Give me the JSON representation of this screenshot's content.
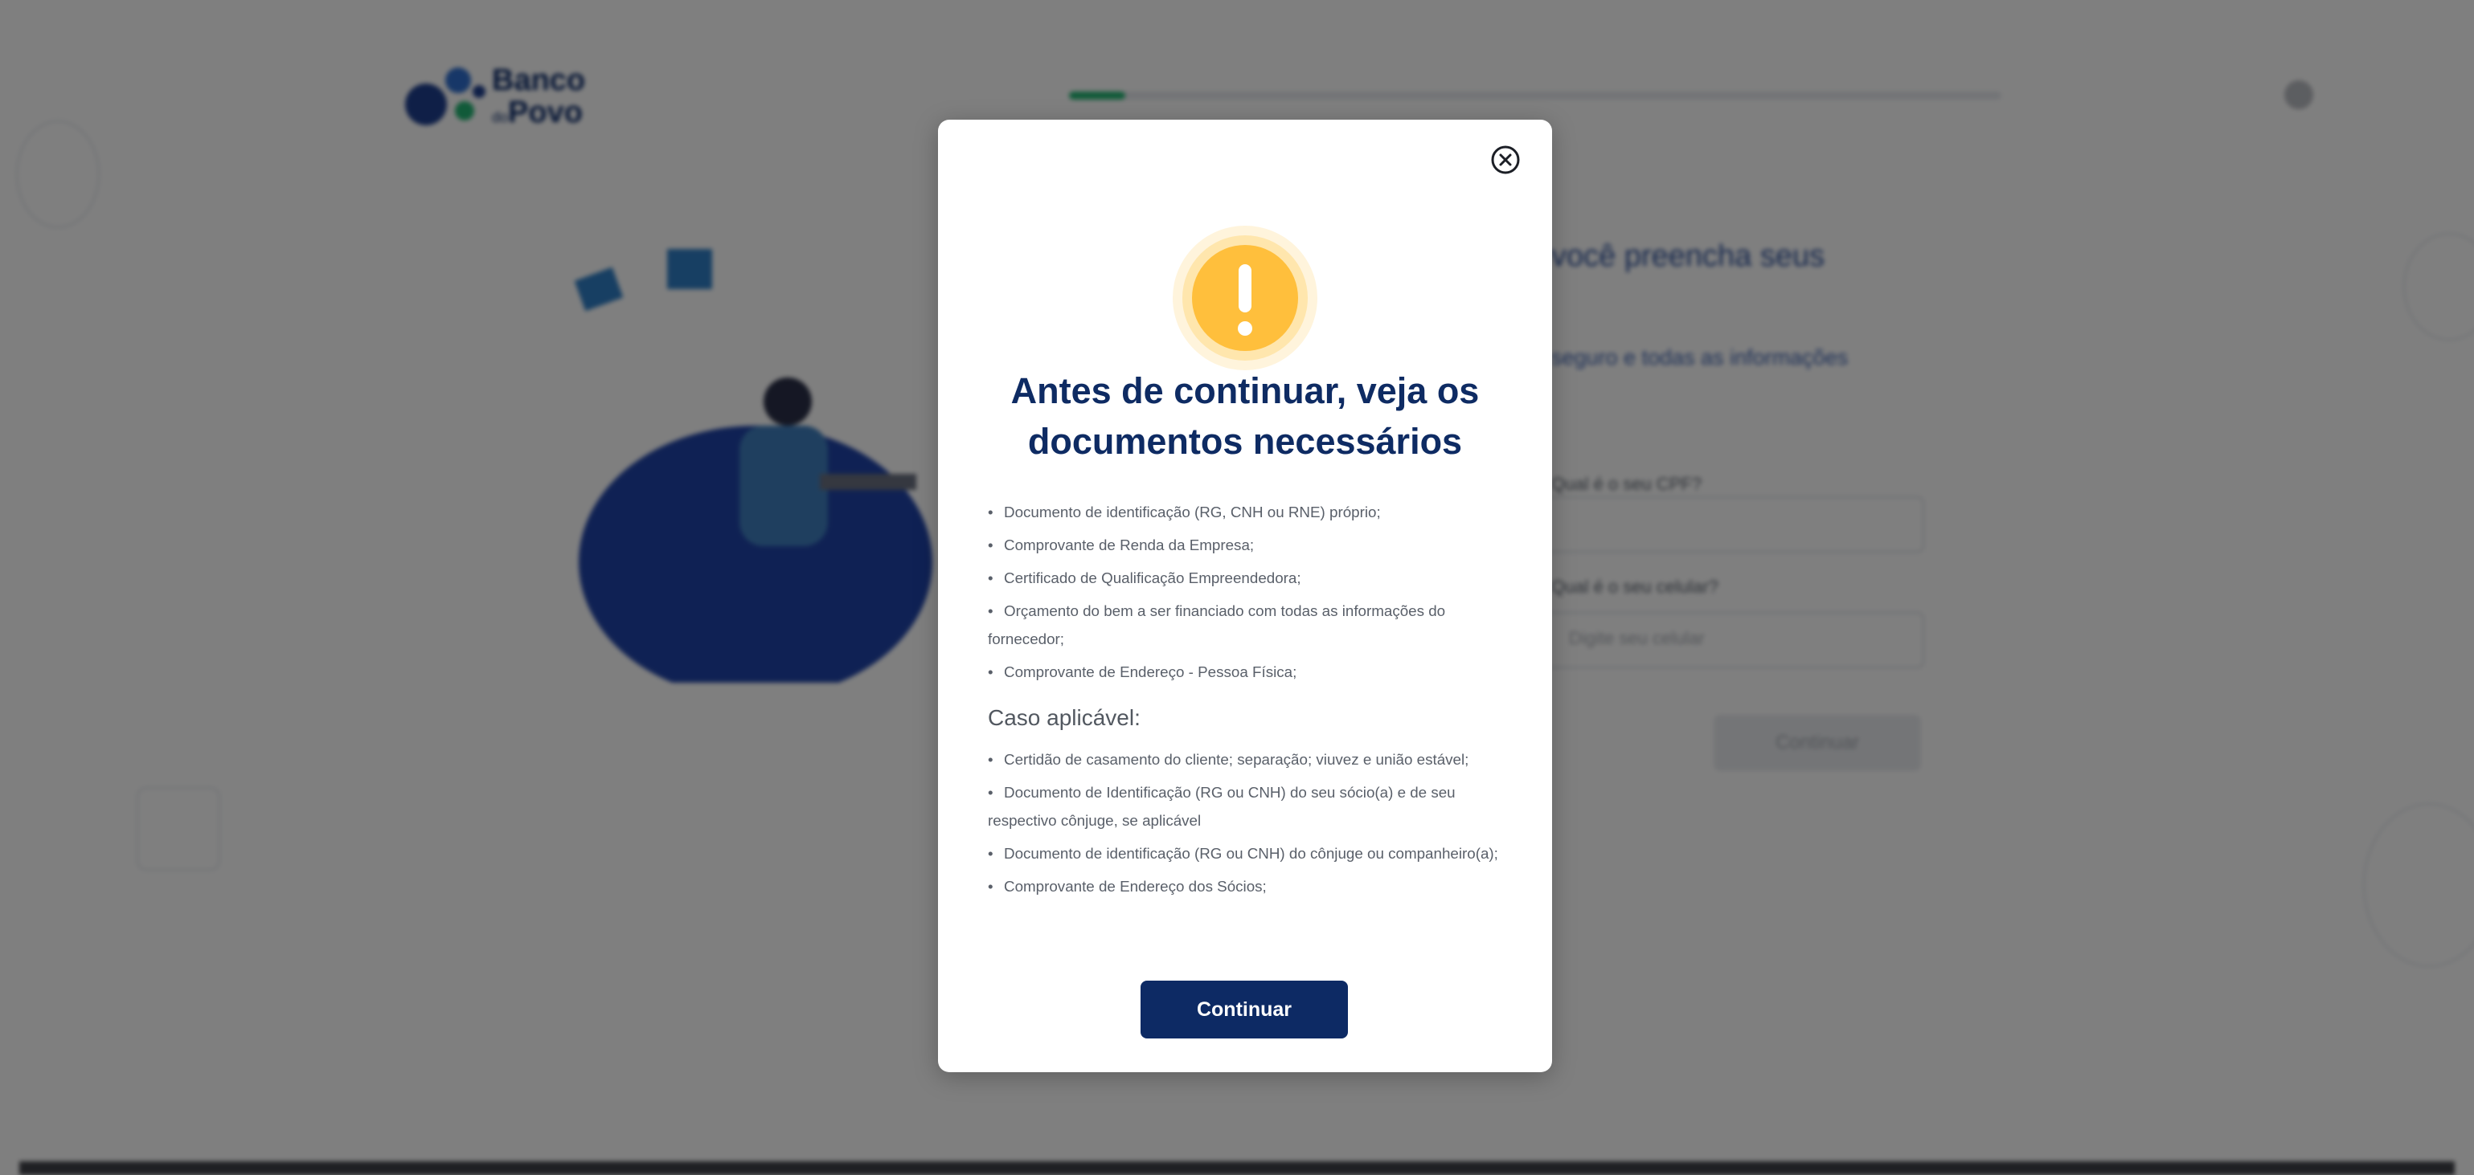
{
  "brand": {
    "logo_line1": "Banco",
    "logo_line2": "Povo",
    "logo_of": "do"
  },
  "form": {
    "heading": "você preencha seus",
    "subheading": "seguro e todas as informações",
    "cpf_label": "Qual é o seu CPF?",
    "phone_label": "Qual é o seu celular?",
    "phone_placeholder": "Digite seu celular",
    "submit_label": "Continuar",
    "progress_fraction": 0.06
  },
  "modal": {
    "title_line1": "Antes de continuar, veja os",
    "title_line2": "documentos necessários",
    "required_docs": [
      "Documento de identificação (RG, CNH ou RNE) próprio;",
      "Comprovante de Renda da Empresa;",
      "Certificado de Qualificação Empreendedora;",
      "Orçamento do bem a ser financiado com todas as informações do fornecedor;",
      "Comprovante de Endereço - Pessoa Física;"
    ],
    "optional_title": "Caso aplicável:",
    "optional_docs": [
      "Certidão de casamento do cliente; separação; viuvez e união estável;",
      "Documento de Identificação (RG ou CNH) do seu sócio(a) e de seu respectivo cônjuge, se aplicável",
      "Documento de identificação (RG ou CNH) do cônjuge ou companheiro(a);",
      "Comprovante de Endereço dos Sócios;"
    ],
    "bullet_char": "•",
    "continue_label": "Continuar",
    "close_icon": "close-circle-icon",
    "warning_icon": "exclamation-warning-icon"
  },
  "colors": {
    "primary": "#0d2a64",
    "warning": "#ffbf3c",
    "progress": "#22b573",
    "overlay": "rgba(0,0,0,0.5)"
  }
}
